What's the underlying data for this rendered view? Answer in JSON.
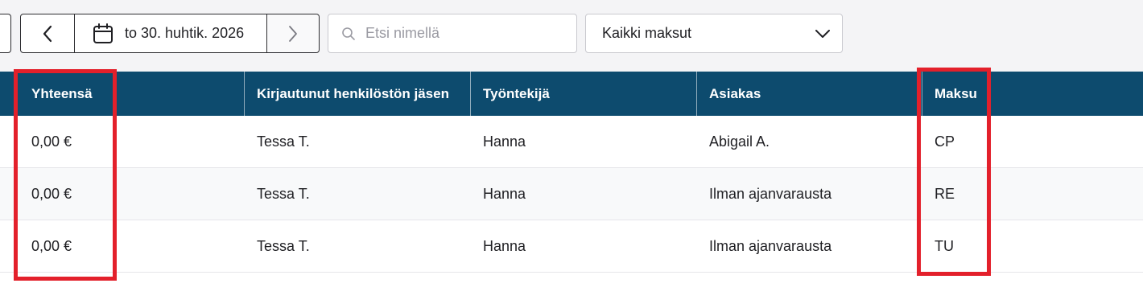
{
  "toolbar": {
    "date_label": "to 30. huhtik. 2026",
    "prev_icon": "chevron-left-icon",
    "next_icon": "chevron-right-icon",
    "calendar_icon": "calendar-icon",
    "search_placeholder": "Etsi nimellä",
    "search_value": "",
    "payment_filter_value": "Kaikki maksut"
  },
  "table": {
    "headers": [
      "Yhteensä",
      "Kirjautunut henkilöstön jäsen",
      "Työntekijä",
      "Asiakas",
      "Maksu"
    ],
    "rows": [
      [
        "0,00 €",
        "Tessa T.",
        "Hanna",
        "Abigail A.",
        "CP"
      ],
      [
        "0,00 €",
        "Tessa T.",
        "Hanna",
        "Ilman ajanvarausta",
        "RE"
      ],
      [
        "0,00 €",
        "Tessa T.",
        "Hanna",
        "Ilman ajanvarausta",
        "TU"
      ]
    ]
  },
  "colors": {
    "header_bg": "#0d4b6e",
    "highlight": "#e3202b"
  }
}
